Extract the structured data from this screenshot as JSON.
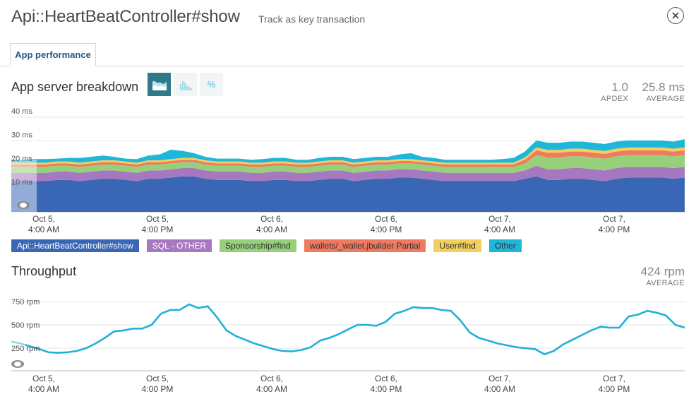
{
  "header": {
    "title": "Api::HeartBeatController#show",
    "track_label": "Track as key transaction"
  },
  "tabs": [
    {
      "label": "App performance"
    }
  ],
  "breakdown": {
    "title": "App server breakdown",
    "view_toggles": [
      {
        "icon": "area-chart-icon",
        "active": true
      },
      {
        "icon": "histogram-icon",
        "active": false
      },
      {
        "icon": "percent-icon",
        "label": "%",
        "active": false
      }
    ],
    "apdex": {
      "value": "1.0",
      "label": "APDEX"
    },
    "average": {
      "value": "25.8 ms",
      "label": "AVERAGE"
    },
    "y_ticks": [
      "40 ms",
      "30 ms",
      "20 ms",
      "10 ms"
    ],
    "x_ticks": [
      {
        "line1": "Oct 5,",
        "line2": "4:00 AM"
      },
      {
        "line1": "Oct 5,",
        "line2": "4:00 PM"
      },
      {
        "line1": "Oct 6,",
        "line2": "4:00 AM"
      },
      {
        "line1": "Oct 6,",
        "line2": "4:00 PM"
      },
      {
        "line1": "Oct 7,",
        "line2": "4:00 AM"
      },
      {
        "line1": "Oct 7,",
        "line2": "4:00 PM"
      }
    ],
    "legend": [
      {
        "label": "Api::HeartBeatController#show",
        "color": "#3a66b6",
        "text_color": "#ffffff"
      },
      {
        "label": "SQL - OTHER",
        "color": "#a678bf",
        "text_color": "#ffffff"
      },
      {
        "label": "Sponsorship#find",
        "color": "#96d07a",
        "text_color": "#333333"
      },
      {
        "label": "wallets/_wallet.jbuilder Partial",
        "color": "#f07a60",
        "text_color": "#333333"
      },
      {
        "label": "User#find",
        "color": "#f3d05b",
        "text_color": "#333333"
      },
      {
        "label": "Other",
        "color": "#1fb6d9",
        "text_color": "#333333"
      }
    ]
  },
  "throughput": {
    "title": "Throughput",
    "average": {
      "value": "424 rpm",
      "label": "AVERAGE"
    },
    "y_ticks": [
      "750 rpm",
      "500 rpm",
      "250 rpm"
    ],
    "x_ticks": [
      {
        "line1": "Oct 5,",
        "line2": "4:00 AM"
      },
      {
        "line1": "Oct 5,",
        "line2": "4:00 PM"
      },
      {
        "line1": "Oct 6,",
        "line2": "4:00 AM"
      },
      {
        "line1": "Oct 6,",
        "line2": "4:00 PM"
      },
      {
        "line1": "Oct 7,",
        "line2": "4:00 AM"
      },
      {
        "line1": "Oct 7,",
        "line2": "4:00 PM"
      }
    ]
  },
  "chart_data": [
    {
      "type": "area",
      "title": "App server breakdown",
      "ylim": [
        0,
        40
      ],
      "series": [
        {
          "name": "Api::HeartBeatController#show",
          "values": [
            13,
            13,
            13,
            13,
            13.5,
            13.5,
            13,
            13.5,
            14,
            14,
            13.5,
            13,
            14,
            14,
            14.5,
            15,
            15,
            14,
            13.5,
            13.5,
            13.5,
            13,
            13,
            13.5,
            13.5,
            13,
            13,
            13.5,
            14,
            14,
            13,
            13.5,
            14,
            14,
            14.5,
            14.5,
            14,
            13.5,
            13,
            13,
            13,
            13,
            13,
            13,
            13,
            14,
            15,
            13.5,
            13.5,
            14,
            14,
            13.5,
            13,
            14,
            14.5,
            14.5,
            14.5,
            14.5,
            14,
            14.5
          ]
        },
        {
          "name": "SQL - OTHER",
          "values": [
            3.5,
            3.5,
            3.5,
            3.5,
            3.5,
            3.5,
            3.5,
            3.5,
            3.5,
            3.5,
            3.5,
            3.5,
            3.5,
            3.5,
            3.5,
            3.5,
            3.5,
            3.5,
            3.5,
            3.5,
            3.5,
            3.5,
            3.5,
            3.5,
            3.5,
            3.5,
            3.5,
            3.5,
            3.5,
            3.5,
            3.5,
            3.5,
            3.5,
            3.5,
            3.5,
            3.5,
            3.5,
            3.5,
            3.5,
            3.5,
            3.5,
            3.5,
            3.5,
            3.5,
            3.5,
            3.5,
            4.5,
            4.5,
            4.5,
            4.5,
            4.5,
            4.5,
            4.5,
            4.5,
            4.5,
            4.5,
            4.5,
            4.5,
            4.5,
            4.5
          ]
        },
        {
          "name": "Sponsorship#find",
          "values": [
            2.5,
            2.5,
            2.5,
            2.5,
            2.5,
            2.5,
            2.5,
            2.5,
            2.5,
            2.5,
            2.5,
            2.5,
            2.5,
            2.5,
            2.5,
            2.5,
            2.5,
            2.5,
            2.5,
            2.5,
            2.5,
            2.5,
            2.5,
            2.5,
            2.5,
            2.5,
            2.5,
            2.5,
            2.5,
            2.5,
            2.5,
            2.5,
            2.5,
            2.5,
            2.5,
            2.5,
            2.5,
            2.5,
            2.5,
            2.5,
            2.5,
            2.5,
            2.5,
            2.5,
            2.5,
            3,
            4.5,
            5,
            5,
            5,
            5,
            5,
            5,
            5,
            5,
            5,
            5,
            5,
            5,
            5
          ]
        },
        {
          "name": "wallets/_wallet.jbuilder Partial",
          "values": [
            1,
            1,
            1,
            1,
            1,
            1,
            1,
            1,
            1,
            1,
            1,
            1,
            1,
            1,
            1,
            1,
            1,
            1,
            1,
            1,
            1,
            1,
            1,
            1,
            1,
            1,
            1,
            1,
            1,
            1,
            1,
            1,
            1,
            1,
            1,
            1,
            1,
            1,
            1,
            1,
            1,
            1,
            1,
            1,
            1,
            1.5,
            2,
            2,
            2,
            2,
            2,
            2,
            2,
            2,
            2,
            2,
            2,
            2,
            2,
            2
          ]
        },
        {
          "name": "User#find",
          "values": [
            0.8,
            0.8,
            0.8,
            0.8,
            0.8,
            0.8,
            0.8,
            0.8,
            0.8,
            0.8,
            0.8,
            0.8,
            0.8,
            0.8,
            0.8,
            0.8,
            0.8,
            0.8,
            0.8,
            0.8,
            0.8,
            0.8,
            0.8,
            0.8,
            0.8,
            0.8,
            0.8,
            0.8,
            0.8,
            0.8,
            0.8,
            0.8,
            0.8,
            0.8,
            0.8,
            0.8,
            0.8,
            0.8,
            0.8,
            0.8,
            0.8,
            0.8,
            0.8,
            0.8,
            0.8,
            1,
            1.2,
            1.2,
            1.2,
            1.2,
            1.2,
            1.2,
            1.2,
            1.2,
            1.2,
            1.2,
            1.2,
            1.2,
            1.2,
            1.2
          ]
        },
        {
          "name": "Other",
          "values": [
            1.2,
            1.2,
            1.5,
            1.5,
            1.2,
            1.5,
            2,
            2,
            2,
            1.5,
            1.2,
            1.5,
            2,
            2.5,
            4,
            3,
            2,
            1.5,
            1.2,
            1.2,
            1.2,
            1.2,
            1.5,
            1.5,
            1.5,
            1.2,
            1.2,
            1.5,
            1.5,
            1.5,
            1.5,
            1.5,
            1.5,
            1.5,
            2,
            2.5,
            1.5,
            1.5,
            1.2,
            1.2,
            1.2,
            1.2,
            1.2,
            1.5,
            2,
            2.5,
            3,
            3,
            3,
            3,
            3,
            3,
            3,
            3,
            3,
            3,
            3,
            3,
            3,
            3.5
          ]
        }
      ]
    },
    {
      "type": "line",
      "title": "Throughput",
      "ylim": [
        0,
        850
      ],
      "series": [
        {
          "name": "Throughput",
          "values": [
            320,
            300,
            270,
            240,
            205,
            200,
            205,
            220,
            250,
            300,
            360,
            430,
            440,
            460,
            460,
            500,
            620,
            660,
            660,
            720,
            680,
            700,
            580,
            440,
            380,
            340,
            300,
            270,
            240,
            220,
            215,
            230,
            260,
            330,
            360,
            400,
            450,
            500,
            500,
            490,
            530,
            620,
            650,
            690,
            680,
            680,
            660,
            650,
            550,
            420,
            360,
            330,
            300,
            280,
            260,
            250,
            240,
            185,
            220,
            290,
            340,
            390,
            440,
            480,
            470,
            470,
            590,
            610,
            650,
            630,
            600,
            500,
            470
          ]
        }
      ]
    }
  ]
}
